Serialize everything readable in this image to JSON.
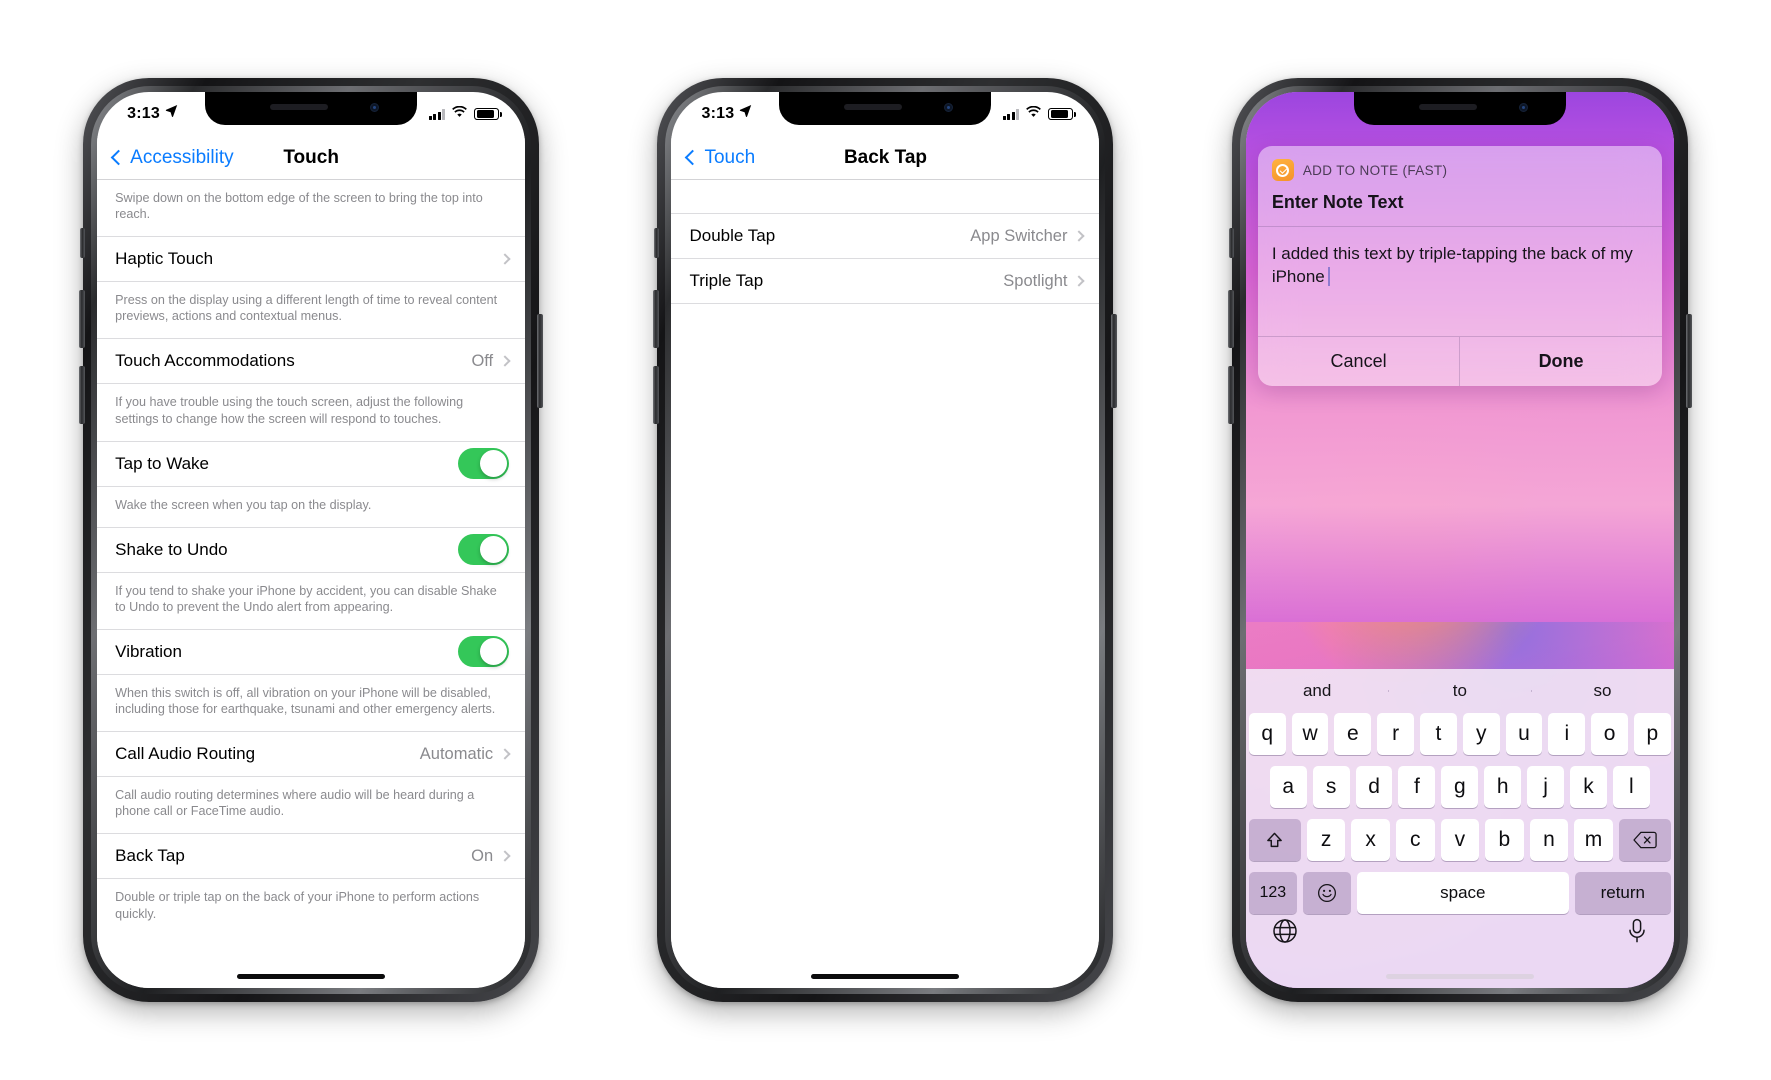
{
  "phone1": {
    "status": {
      "time": "3:13",
      "location_icon": "location-arrow-icon",
      "signal_icon": "cellular-signal-icon",
      "wifi_icon": "wifi-icon",
      "battery_icon": "battery-icon"
    },
    "nav": {
      "back_label": "Accessibility",
      "title": "Touch"
    },
    "rows": [
      {
        "type": "footnote",
        "text": "Swipe down on the bottom edge of the screen to bring the top into reach."
      },
      {
        "type": "cell",
        "label": "Haptic Touch",
        "value": "",
        "accessory": "chevron"
      },
      {
        "type": "footnote",
        "text": "Press on the display using a different length of time to reveal content previews, actions and contextual menus."
      },
      {
        "type": "cell",
        "label": "Touch Accommodations",
        "value": "Off",
        "accessory": "chevron"
      },
      {
        "type": "footnote",
        "text": "If you have trouble using the touch screen, adjust the following settings to change how the screen will respond to touches."
      },
      {
        "type": "cell",
        "label": "Tap to Wake",
        "value": "",
        "accessory": "toggle-on"
      },
      {
        "type": "footnote",
        "text": "Wake the screen when you tap on the display."
      },
      {
        "type": "cell",
        "label": "Shake to Undo",
        "value": "",
        "accessory": "toggle-on"
      },
      {
        "type": "footnote",
        "text": "If you tend to shake your iPhone by accident, you can disable Shake to Undo to prevent the Undo alert from appearing."
      },
      {
        "type": "cell",
        "label": "Vibration",
        "value": "",
        "accessory": "toggle-on"
      },
      {
        "type": "footnote",
        "text": "When this switch is off, all vibration on your iPhone will be disabled, including those for earthquake, tsunami and other emergency alerts."
      },
      {
        "type": "cell",
        "label": "Call Audio Routing",
        "value": "Automatic",
        "accessory": "chevron"
      },
      {
        "type": "footnote",
        "text": "Call audio routing determines where audio will be heard during a phone call or FaceTime audio."
      },
      {
        "type": "cell",
        "label": "Back Tap",
        "value": "On",
        "accessory": "chevron"
      },
      {
        "type": "footnote",
        "text": "Double or triple tap on the back of your iPhone to perform actions quickly."
      }
    ]
  },
  "phone2": {
    "status": {
      "time": "3:13"
    },
    "nav": {
      "back_label": "Touch",
      "title": "Back Tap"
    },
    "rows": [
      {
        "label": "Double Tap",
        "value": "App Switcher"
      },
      {
        "label": "Triple Tap",
        "value": "Spotlight"
      }
    ]
  },
  "phone3": {
    "dialog": {
      "app_name": "ADD TO NOTE (FAST)",
      "icon": "shortcuts-check-icon",
      "title": "Enter Note Text",
      "input_value": "I added this text by triple-tapping the back of my iPhone",
      "cancel_label": "Cancel",
      "done_label": "Done"
    },
    "keyboard": {
      "predictions": [
        "and",
        "to",
        "so"
      ],
      "row1": [
        "q",
        "w",
        "e",
        "r",
        "t",
        "y",
        "u",
        "i",
        "o",
        "p"
      ],
      "row2": [
        "a",
        "s",
        "d",
        "f",
        "g",
        "h",
        "j",
        "k",
        "l"
      ],
      "row3": [
        "z",
        "x",
        "c",
        "v",
        "b",
        "n",
        "m"
      ],
      "shift_icon": "shift-arrow-icon",
      "delete_icon": "backspace-icon",
      "numbers_label": "123",
      "emoji_icon": "smiley-face-icon",
      "space_label": "space",
      "return_label": "return",
      "globe_icon": "globe-icon",
      "mic_icon": "microphone-icon"
    }
  },
  "colors": {
    "accent_blue": "#0a7cff",
    "toggle_green": "#34c759",
    "secondary_text": "#8a8a8e"
  }
}
